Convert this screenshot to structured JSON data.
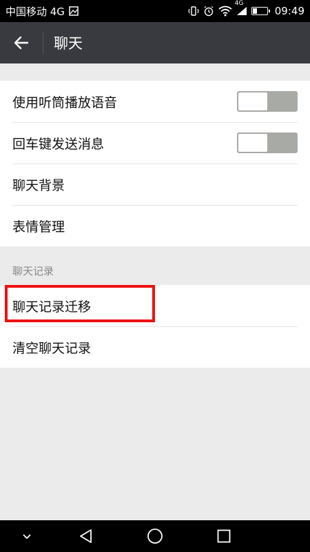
{
  "status_bar": {
    "carrier": "中国移动 4G",
    "signal_label": "4G",
    "time": "09:49"
  },
  "header": {
    "title": "聊天"
  },
  "settings": {
    "rows": [
      {
        "label": "使用听筒播放语音",
        "toggle": "off"
      },
      {
        "label": "回车键发送消息",
        "toggle": "off"
      },
      {
        "label": "聊天背景"
      },
      {
        "label": "表情管理"
      }
    ]
  },
  "history": {
    "section_title": "聊天记录",
    "rows": [
      {
        "label": "聊天记录迁移"
      },
      {
        "label": "清空聊天记录"
      }
    ]
  },
  "colors": {
    "appbar": "#393a3f",
    "highlight": "#ee1111",
    "toggle_off": "#a8aaa5"
  }
}
